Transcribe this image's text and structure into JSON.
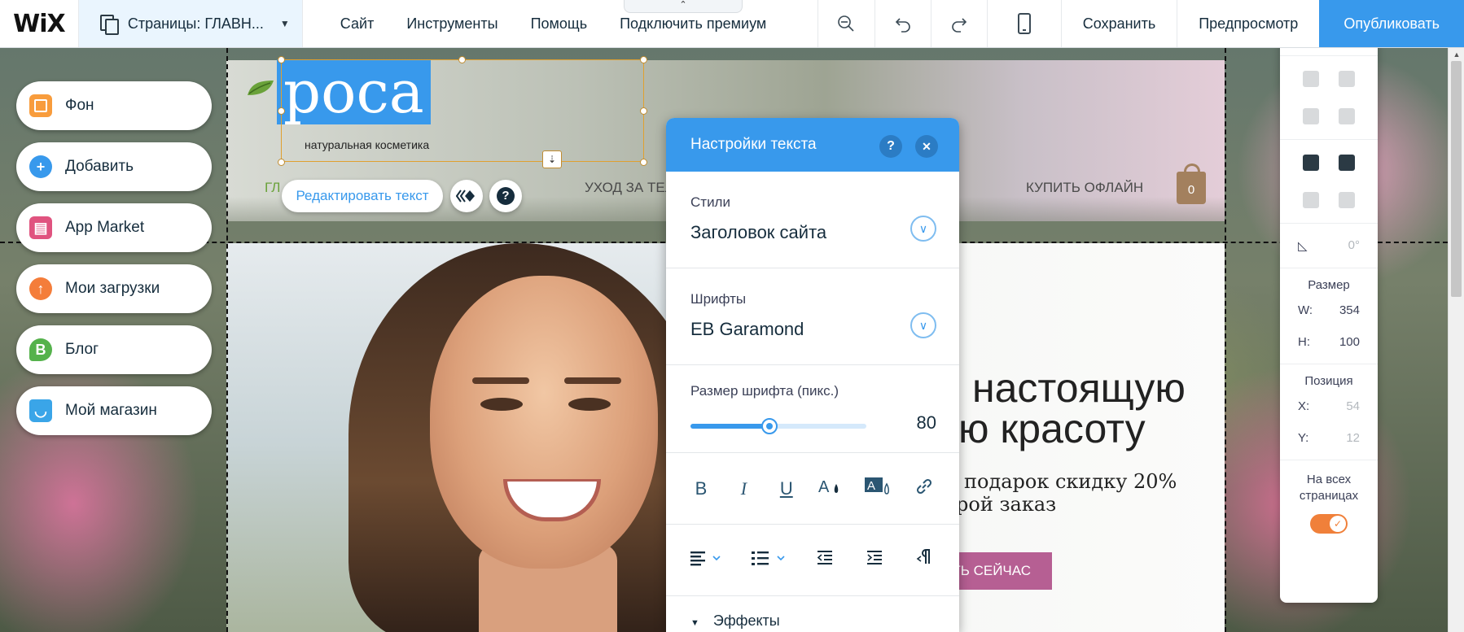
{
  "toolbar": {
    "logo": "WiX",
    "pages_label": "Страницы: ГЛАВН...",
    "menu": [
      "Сайт",
      "Инструменты",
      "Помощь",
      "Подключить премиум"
    ],
    "save_label": "Сохранить",
    "preview_label": "Предпросмотр",
    "publish_label": "Опубликовать",
    "accent": "#3899ec"
  },
  "left_panel": {
    "items": [
      {
        "label": "Фон",
        "icon": "background-icon",
        "color": "#f89c3c"
      },
      {
        "label": "Добавить",
        "icon": "plus-icon",
        "color": "#3899ec"
      },
      {
        "label": "App Market",
        "icon": "store-icon",
        "color": "#e0537f"
      },
      {
        "label": "Мои загрузки",
        "icon": "upload-icon",
        "color": "#f47d3a"
      },
      {
        "label": "Блог",
        "icon": "blog-icon",
        "color": "#55b24c"
      },
      {
        "label": "Мой магазин",
        "icon": "shopping-bag-icon",
        "color": "#3aa5e8"
      }
    ]
  },
  "site": {
    "brand": "роса",
    "tagline": "натуральная косметика",
    "nav": [
      "ГЛ",
      "ГЛАВ",
      "УХОД ЗА ТЕЛ",
      "КУПИТЬ ОФЛАЙН"
    ],
    "cart_count": "0",
    "edit_text_label": "Редактировать текст",
    "hero_title_1": "настоящую",
    "hero_title_2": "ую красоту",
    "hero_sub_1": "подарок скидку 20%",
    "hero_sub_2": "рой заказ",
    "hero_cta": "ТЬ СЕЙЧАС",
    "cta_color": "#b65f93"
  },
  "text_settings": {
    "title": "Настройки текста",
    "help": "?",
    "close": "✕",
    "styles_label": "Стили",
    "styles_value": "Заголовок сайта",
    "fonts_label": "Шрифты",
    "fonts_value": "EB Garamond",
    "size_label": "Размер шрифта (пикс.)",
    "size_value": "80",
    "size_fraction": 0.45,
    "format_buttons": [
      "B",
      "I",
      "U"
    ],
    "effects_label": "Эффекты"
  },
  "layout_panel": {
    "help": "?",
    "rotation": "0°",
    "size_title": "Размер",
    "w_label": "W:",
    "w_value": "354",
    "h_label": "H:",
    "h_value": "100",
    "position_title": "Позиция",
    "x_label": "X:",
    "x_value": "54",
    "y_label": "Y:",
    "y_value": "12",
    "all_pages_label": "На всех страницах",
    "toggle_on_color": "#f0803a"
  }
}
